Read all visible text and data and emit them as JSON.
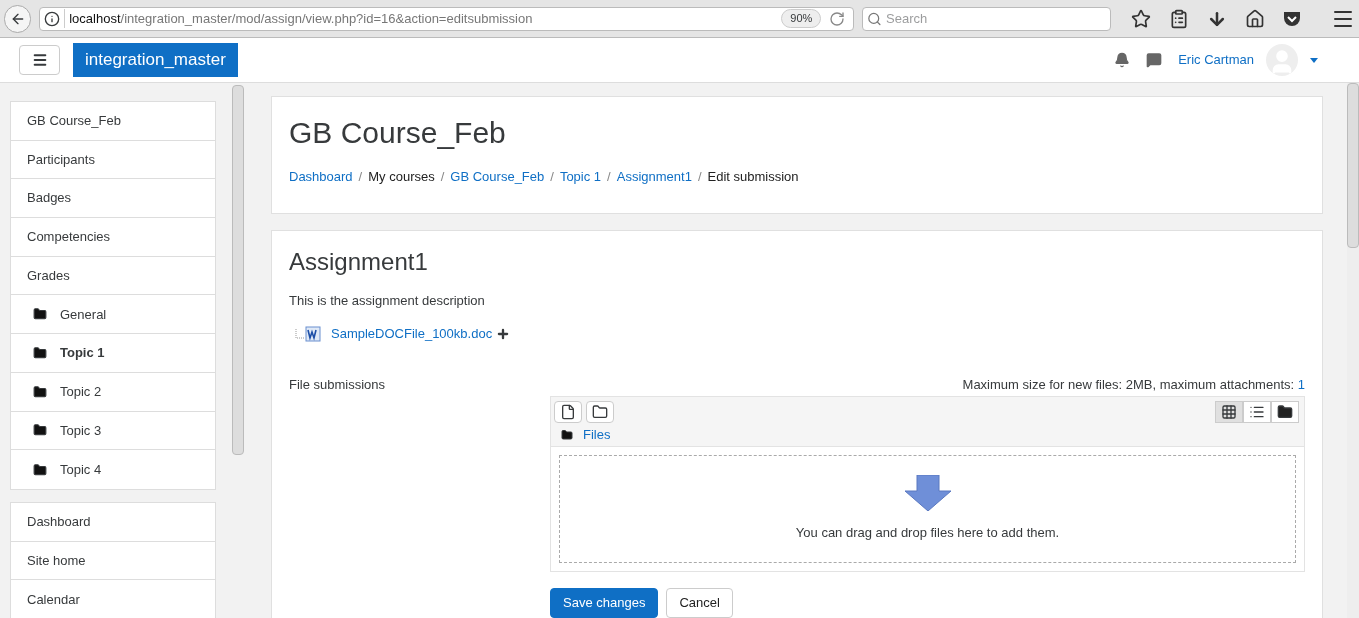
{
  "browser": {
    "url_host": "localhost",
    "url_path": "/integration_master/mod/assign/view.php?id=16&action=editsubmission",
    "zoom": "90%",
    "search_placeholder": "Search"
  },
  "navbar": {
    "site_name": "integration_master",
    "user_name": "Eric Cartman"
  },
  "sidebar": {
    "groups": [
      [
        {
          "label": "GB Course_Feb",
          "kind": "plain",
          "selected": false
        },
        {
          "label": "Participants",
          "kind": "plain",
          "selected": false
        },
        {
          "label": "Badges",
          "kind": "plain",
          "selected": false
        },
        {
          "label": "Competencies",
          "kind": "plain",
          "selected": false
        },
        {
          "label": "Grades",
          "kind": "plain",
          "selected": false
        },
        {
          "label": "General",
          "kind": "folder",
          "selected": false
        },
        {
          "label": "Topic 1",
          "kind": "folder",
          "selected": true
        },
        {
          "label": "Topic 2",
          "kind": "folder",
          "selected": false
        },
        {
          "label": "Topic 3",
          "kind": "folder",
          "selected": false
        },
        {
          "label": "Topic 4",
          "kind": "folder",
          "selected": false
        }
      ],
      [
        {
          "label": "Dashboard",
          "kind": "plain",
          "selected": false
        },
        {
          "label": "Site home",
          "kind": "plain",
          "selected": false
        },
        {
          "label": "Calendar",
          "kind": "plain",
          "selected": false
        }
      ]
    ]
  },
  "header": {
    "title": "GB Course_Feb",
    "separator": "/",
    "breadcrumbs": [
      {
        "label": "Dashboard",
        "link": true
      },
      {
        "label": "My courses",
        "link": false
      },
      {
        "label": "GB Course_Feb",
        "link": true
      },
      {
        "label": "Topic 1",
        "link": true
      },
      {
        "label": "Assignment1",
        "link": true
      },
      {
        "label": "Edit submission",
        "link": false
      }
    ]
  },
  "assignment": {
    "title": "Assignment1",
    "description": "This is the assignment description",
    "attachment": "SampleDOCFile_100kb.doc",
    "file_submissions": {
      "label": "File submissions",
      "limits": "Maximum size for new files: 2MB, maximum attachments:",
      "max_attachments": "1",
      "folder": "Files",
      "drop_hint": "You can drag and drop files here to add them.",
      "view_modes": [
        {
          "kind": "grid",
          "selected": true
        },
        {
          "kind": "list",
          "selected": false
        },
        {
          "kind": "tree",
          "selected": false
        }
      ]
    },
    "buttons": [
      {
        "label": "Save changes",
        "kind": "primary"
      },
      {
        "label": "Cancel",
        "kind": "secondary"
      }
    ]
  }
}
